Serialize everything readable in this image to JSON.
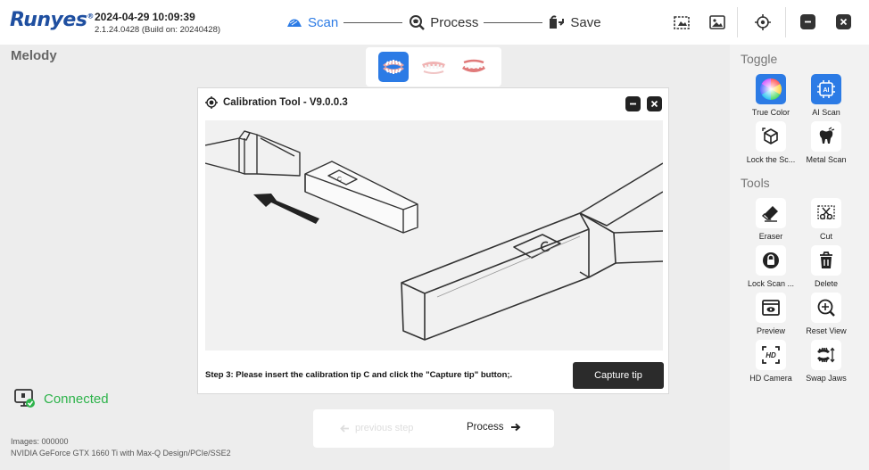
{
  "header": {
    "logo": "Runyes",
    "datetime": "2024-04-29 10:09:39",
    "version": "2.1.24.0428 (Build on: 20240428)",
    "steps": [
      {
        "label": "Scan",
        "icon": "scan-icon",
        "active": true
      },
      {
        "label": "Process",
        "icon": "process-icon",
        "active": false
      },
      {
        "label": "Save",
        "icon": "save-icon",
        "active": false
      }
    ],
    "accent_color": "#2c7be5"
  },
  "patient": {
    "name": "Melody"
  },
  "dialog": {
    "title": "Calibration Tool - V9.0.0.3",
    "instruction": "Step 3: Please insert the calibration tip C and click the \"Capture tip\" button;.",
    "capture_label": "Capture tip",
    "tip_letter": "C"
  },
  "status": {
    "connection": "Connected",
    "connection_color": "#2db34a",
    "images": "Images: 000000",
    "gpu": "NVIDIA GeForce GTX 1660 Ti with Max-Q Design/PCIe/SSE2"
  },
  "nav": {
    "previous": "previous step",
    "process": "Process"
  },
  "sidebar": {
    "toggle_title": "Toggle",
    "tools_title": "Tools",
    "toggles": [
      {
        "label": "True Color",
        "icon": "color-wheel-icon",
        "on": true
      },
      {
        "label": "AI Scan",
        "icon": "ai-chip-icon",
        "on": true
      },
      {
        "label": "Lock the Sc...",
        "icon": "cube-icon",
        "on": false
      },
      {
        "label": "Metal Scan",
        "icon": "metal-tooth-icon",
        "on": false
      }
    ],
    "tools": [
      {
        "label": "Eraser",
        "icon": "eraser-icon"
      },
      {
        "label": "Cut",
        "icon": "cut-icon"
      },
      {
        "label": "Lock Scan ...",
        "icon": "lock-icon"
      },
      {
        "label": "Delete",
        "icon": "trash-icon"
      },
      {
        "label": "Preview",
        "icon": "preview-icon"
      },
      {
        "label": "Reset View",
        "icon": "reset-view-icon"
      },
      {
        "label": "HD Camera",
        "icon": "hd-camera-icon"
      },
      {
        "label": "Swap Jaws",
        "icon": "swap-jaws-icon"
      }
    ]
  }
}
